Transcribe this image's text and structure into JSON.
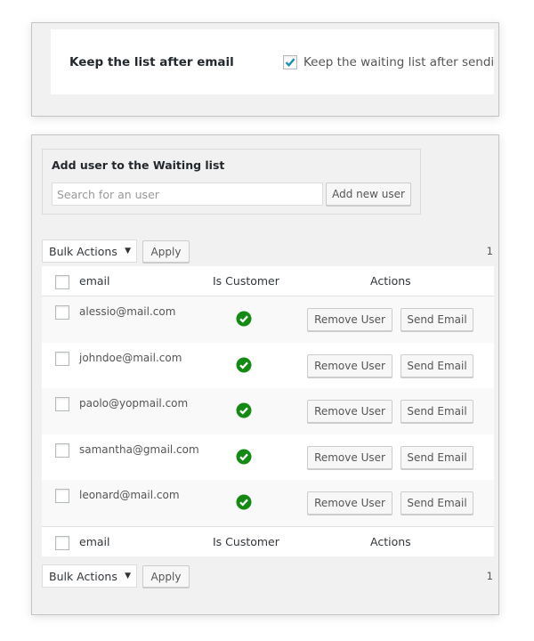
{
  "settings": {
    "label": "Keep the list after email",
    "checkbox_checked": true,
    "checkbox_text": "Keep the waiting list after sendi"
  },
  "add_user": {
    "title": "Add user to the Waiting list",
    "search_placeholder": "Search for an user",
    "search_value": "",
    "add_button": "Add new user"
  },
  "tablenav_top": {
    "bulk_actions": "Bulk Actions",
    "apply": "Apply",
    "page": "1"
  },
  "tablenav_bottom": {
    "bulk_actions": "Bulk Actions",
    "apply": "Apply",
    "page": "1"
  },
  "table": {
    "columns": {
      "email": "email",
      "is_customer": "Is Customer",
      "actions": "Actions"
    },
    "rows": [
      {
        "email": "alessio@mail.com",
        "is_customer": true,
        "remove": "Remove User",
        "send": "Send Email"
      },
      {
        "email": "johndoe@mail.com",
        "is_customer": true,
        "remove": "Remove User",
        "send": "Send Email"
      },
      {
        "email": "paolo@yopmail.com",
        "is_customer": true,
        "remove": "Remove User",
        "send": "Send Email"
      },
      {
        "email": "samantha@gmail.com",
        "is_customer": true,
        "remove": "Remove User",
        "send": "Send Email"
      },
      {
        "email": "leonard@mail.com",
        "is_customer": true,
        "remove": "Remove User",
        "send": "Send Email"
      }
    ]
  },
  "icons": {
    "customer_check": "check-circle-icon",
    "dropdown": "triangle-down-icon"
  },
  "colors": {
    "check_green": "#148a14",
    "checkbox_blue": "#1e8cbe"
  }
}
